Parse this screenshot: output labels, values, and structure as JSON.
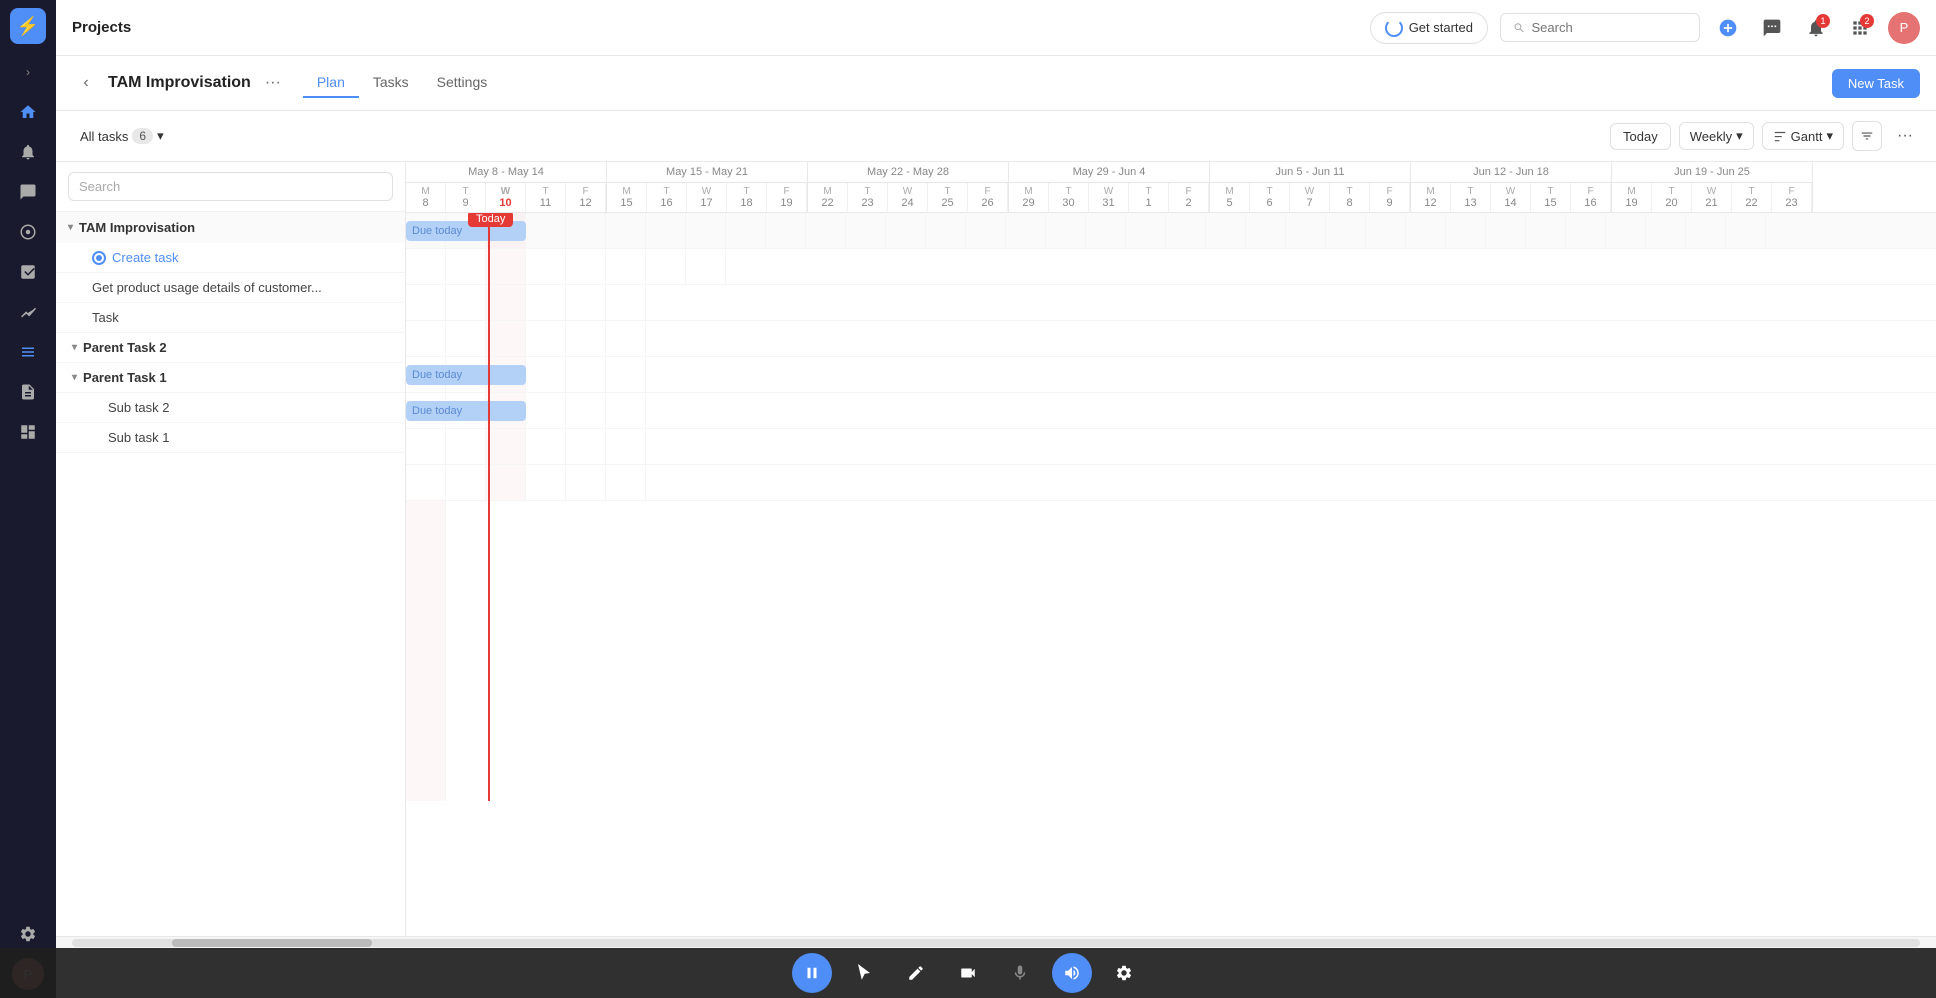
{
  "app": {
    "title": "Projects"
  },
  "topbar": {
    "get_started": "Get started",
    "search_placeholder": "Search",
    "plus_icon": "+",
    "messages_badge": null,
    "notifications_badge": "1",
    "apps_badge": "2"
  },
  "project": {
    "title": "TAM Improvisation",
    "tabs": [
      "Plan",
      "Tasks",
      "Settings"
    ],
    "active_tab": 0,
    "new_task_label": "New Task"
  },
  "toolbar": {
    "all_tasks": "All tasks",
    "task_count": "6",
    "today": "Today",
    "weekly": "Weekly",
    "gantt": "Gantt"
  },
  "tasks": {
    "group_name": "TAM Improvisation",
    "items": [
      {
        "id": "create-task",
        "label": "Create task",
        "type": "create",
        "indent": 1
      },
      {
        "id": "task-get-product",
        "label": "Get product usage details of customer...",
        "type": "task",
        "indent": 1
      },
      {
        "id": "task-task",
        "label": "Task",
        "type": "task",
        "indent": 1
      },
      {
        "id": "parent-task-2",
        "label": "Parent Task 2",
        "type": "parent",
        "indent": 0
      },
      {
        "id": "parent-task-1",
        "label": "Parent Task 1",
        "type": "parent",
        "indent": 0
      },
      {
        "id": "sub-task-2",
        "label": "Sub task 2",
        "type": "task",
        "indent": 2
      },
      {
        "id": "sub-task-1",
        "label": "Sub task 1",
        "type": "task",
        "indent": 2
      }
    ]
  },
  "gantt": {
    "weeks": [
      {
        "label": "May 8 - May 14",
        "days": [
          {
            "letter": "M",
            "num": "8"
          },
          {
            "letter": "T",
            "num": "9"
          },
          {
            "letter": "W",
            "num": "10"
          },
          {
            "letter": "T",
            "num": "11"
          },
          {
            "letter": "F",
            "num": "12"
          }
        ]
      },
      {
        "label": "May 15 - May 21",
        "days": [
          {
            "letter": "M",
            "num": "15"
          },
          {
            "letter": "T",
            "num": "16"
          },
          {
            "letter": "W",
            "num": "17"
          },
          {
            "letter": "T",
            "num": "18"
          },
          {
            "letter": "F",
            "num": "19"
          }
        ]
      },
      {
        "label": "May 22 - May 28",
        "days": [
          {
            "letter": "M",
            "num": "22"
          },
          {
            "letter": "T",
            "num": "23"
          },
          {
            "letter": "W",
            "num": "24"
          },
          {
            "letter": "T",
            "num": "25"
          },
          {
            "letter": "F",
            "num": "26"
          }
        ]
      },
      {
        "label": "May 29 - Jun 4",
        "days": [
          {
            "letter": "M",
            "num": "29"
          },
          {
            "letter": "T",
            "num": "30"
          },
          {
            "letter": "W",
            "num": "31"
          },
          {
            "letter": "T",
            "num": "1"
          },
          {
            "letter": "F",
            "num": "2"
          }
        ]
      },
      {
        "label": "Jun 5 - Jun 11",
        "days": [
          {
            "letter": "M",
            "num": "5"
          },
          {
            "letter": "T",
            "num": "6"
          },
          {
            "letter": "W",
            "num": "7"
          },
          {
            "letter": "T",
            "num": "8"
          },
          {
            "letter": "F",
            "num": "9"
          }
        ]
      },
      {
        "label": "Jun 12 - Jun 18",
        "days": [
          {
            "letter": "M",
            "num": "12"
          },
          {
            "letter": "T",
            "num": "13"
          },
          {
            "letter": "W",
            "num": "14"
          },
          {
            "letter": "T",
            "num": "15"
          },
          {
            "letter": "F",
            "num": "16"
          }
        ]
      },
      {
        "label": "Jun 19 - Jun 25",
        "days": [
          {
            "letter": "M",
            "num": "19"
          },
          {
            "letter": "T",
            "num": "20"
          },
          {
            "letter": "W",
            "num": "21"
          },
          {
            "letter": "T",
            "num": "22"
          },
          {
            "letter": "F",
            "num": "23"
          }
        ]
      }
    ],
    "today_col_index": 2,
    "today_label": "Today",
    "bars": [
      {
        "row": 0,
        "start_col": 0,
        "width_cols": 3,
        "label": "Due today",
        "color": "blue"
      },
      {
        "row": 3,
        "start_col": 0,
        "width_cols": 3,
        "label": "Due today",
        "color": "blue"
      },
      {
        "row": 4,
        "start_col": 0,
        "width_cols": 3,
        "label": "Due today",
        "color": "blue"
      }
    ]
  },
  "sidebar": {
    "logo": "⚡",
    "items": [
      {
        "id": "home",
        "icon": "⊞",
        "label": "Home"
      },
      {
        "id": "notifications",
        "icon": "🔔",
        "label": "Notifications"
      },
      {
        "id": "chat",
        "icon": "💬",
        "label": "Chat"
      },
      {
        "id": "goals",
        "icon": "◎",
        "label": "Goals"
      },
      {
        "id": "projects",
        "icon": "📋",
        "label": "Projects",
        "active": true
      },
      {
        "id": "pulse",
        "icon": "📊",
        "label": "Pulse"
      },
      {
        "id": "docs",
        "icon": "📄",
        "label": "Docs"
      },
      {
        "id": "dashboards",
        "icon": "▦",
        "label": "Dashboards"
      }
    ],
    "bottom_items": [
      {
        "id": "settings",
        "icon": "⚙",
        "label": "Settings"
      }
    ]
  },
  "bottom_toolbar": {
    "tools": [
      {
        "id": "cursor",
        "icon": "↖",
        "label": "Cursor tool"
      },
      {
        "id": "pen",
        "icon": "✏",
        "label": "Pen tool"
      },
      {
        "id": "camera",
        "icon": "📷",
        "label": "Camera tool"
      },
      {
        "id": "mic",
        "icon": "🎤",
        "label": "Microphone tool"
      },
      {
        "id": "speaker",
        "icon": "🔊",
        "label": "Speaker tool",
        "active": true
      },
      {
        "id": "settings",
        "icon": "⚙",
        "label": "Settings tool"
      }
    ],
    "pause_icon": "⏸"
  }
}
